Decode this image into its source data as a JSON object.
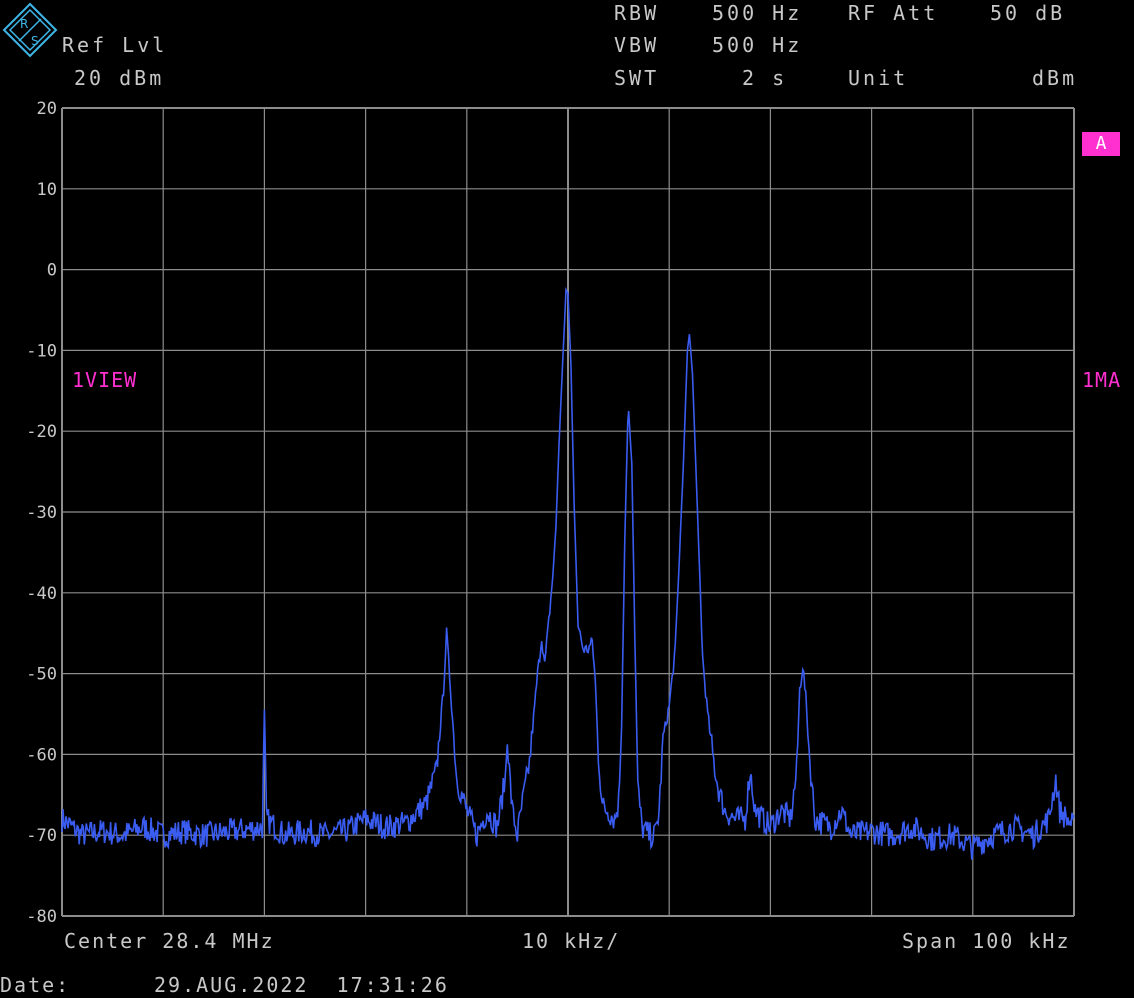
{
  "header": {
    "ref_lvl_label": "Ref Lvl",
    "ref_lvl_value": "20 dBm",
    "rbw_label": "RBW",
    "rbw_value": "500 Hz",
    "vbw_label": "VBW",
    "vbw_value": "500 Hz",
    "swt_label": "SWT",
    "swt_value": "2 s",
    "rf_att_label": "RF Att",
    "rf_att_value": "50 dB",
    "unit_label": "Unit",
    "unit_value": "dBm"
  },
  "side_labels": {
    "left": "1VIEW",
    "right": "1MA",
    "trace_badge": "A"
  },
  "footer": {
    "center": "Center 28.4 MHz",
    "div": "10 kHz/",
    "span": "Span 100 kHz",
    "date_label": "Date:",
    "date_value": "29.AUG.2022  17:31:26"
  },
  "colors": {
    "trace": "#3a5cf0",
    "grid": "#8c8c8c",
    "annotation": "#ff2fd0",
    "logo": "#3fb6e8"
  },
  "logo_text": "R&S",
  "chart_data": {
    "type": "line",
    "title": "",
    "xlabel": "",
    "ylabel": "",
    "xlim": [
      -50,
      50
    ],
    "ylim": [
      -80,
      20
    ],
    "x_unit": "kHz offset from 28.4 MHz",
    "y_ticks": [
      20,
      10,
      0,
      -10,
      -20,
      -30,
      -40,
      -50,
      -60,
      -70,
      -80
    ],
    "grid": true,
    "series": [
      {
        "points": [
          [
            -50,
            -68
          ],
          [
            -48,
            -70
          ],
          [
            -46,
            -69.5
          ],
          [
            -44,
            -70
          ],
          [
            -42,
            -69
          ],
          [
            -40,
            -70
          ],
          [
            -38,
            -69.5
          ],
          [
            -36,
            -70
          ],
          [
            -33,
            -69.5
          ],
          [
            -30.2,
            -69
          ],
          [
            -30,
            -55
          ],
          [
            -29.8,
            -68
          ],
          [
            -28,
            -70
          ],
          [
            -26,
            -69.5
          ],
          [
            -24,
            -70
          ],
          [
            -22,
            -69.5
          ],
          [
            -20,
            -68
          ],
          [
            -18,
            -69
          ],
          [
            -16,
            -68.5
          ],
          [
            -14,
            -66
          ],
          [
            -13,
            -62
          ],
          [
            -12.3,
            -52
          ],
          [
            -12,
            -45
          ],
          [
            -11.6,
            -52
          ],
          [
            -11,
            -63
          ],
          [
            -10,
            -67
          ],
          [
            -9,
            -70
          ],
          [
            -8,
            -67
          ],
          [
            -7,
            -69
          ],
          [
            -6.2,
            -63
          ],
          [
            -6,
            -58
          ],
          [
            -5.8,
            -62
          ],
          [
            -5.5,
            -67
          ],
          [
            -5,
            -70
          ],
          [
            -4.5,
            -66
          ],
          [
            -3.8,
            -61
          ],
          [
            -3,
            -50
          ],
          [
            -2.6,
            -45.5
          ],
          [
            -2.3,
            -49
          ],
          [
            -1.5,
            -38
          ],
          [
            -1.2,
            -32
          ],
          [
            -0.9,
            -22
          ],
          [
            -0.4,
            -8
          ],
          [
            -0.2,
            -2.5
          ],
          [
            0,
            -3
          ],
          [
            0.3,
            -12
          ],
          [
            0.6,
            -29
          ],
          [
            1,
            -44
          ],
          [
            1.5,
            -47
          ],
          [
            2,
            -47
          ],
          [
            2.4,
            -46
          ],
          [
            2.7,
            -51
          ],
          [
            3,
            -60
          ],
          [
            3.4,
            -66.5
          ],
          [
            4,
            -67
          ],
          [
            4.6,
            -68
          ],
          [
            5,
            -66
          ],
          [
            5.3,
            -56
          ],
          [
            5.6,
            -34
          ],
          [
            5.9,
            -19
          ],
          [
            6,
            -17.5
          ],
          [
            6.3,
            -24
          ],
          [
            6.6,
            -45
          ],
          [
            6.9,
            -64
          ],
          [
            7.3,
            -69
          ],
          [
            8,
            -70
          ],
          [
            8.6,
            -70
          ],
          [
            9,
            -67
          ],
          [
            9.4,
            -58
          ],
          [
            10,
            -54
          ],
          [
            10.6,
            -47
          ],
          [
            11,
            -36
          ],
          [
            11.4,
            -24
          ],
          [
            11.8,
            -10
          ],
          [
            12,
            -8
          ],
          [
            12.3,
            -13
          ],
          [
            12.8,
            -30
          ],
          [
            13.3,
            -48
          ],
          [
            13.8,
            -55
          ],
          [
            14.3,
            -60
          ],
          [
            14.8,
            -64
          ],
          [
            15.5,
            -67
          ],
          [
            16.5,
            -68
          ],
          [
            17.5,
            -68
          ],
          [
            18,
            -62
          ],
          [
            18.5,
            -67
          ],
          [
            20,
            -69
          ],
          [
            21,
            -67
          ],
          [
            22,
            -68
          ],
          [
            22.6,
            -62
          ],
          [
            22.9,
            -52
          ],
          [
            23.2,
            -49
          ],
          [
            23.5,
            -53
          ],
          [
            23.9,
            -61
          ],
          [
            24.4,
            -68
          ],
          [
            26,
            -69
          ],
          [
            27,
            -67
          ],
          [
            28,
            -70
          ],
          [
            30,
            -69.5
          ],
          [
            32,
            -70
          ],
          [
            34,
            -69
          ],
          [
            36,
            -70.5
          ],
          [
            38,
            -70
          ],
          [
            40,
            -71.5
          ],
          [
            42,
            -70
          ],
          [
            44,
            -69
          ],
          [
            46,
            -70
          ],
          [
            47.5,
            -68
          ],
          [
            48.2,
            -63
          ],
          [
            48.6,
            -67
          ],
          [
            50,
            -69
          ]
        ]
      }
    ]
  }
}
